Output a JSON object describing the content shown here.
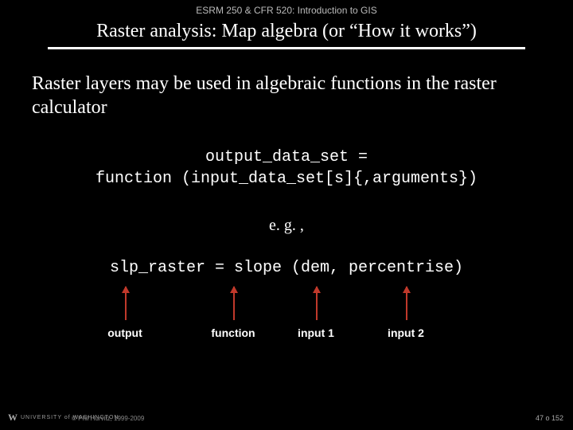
{
  "header": {
    "course": "ESRM 250 & CFR 520: Introduction to GIS"
  },
  "title": "Raster analysis: Map algebra (or “How it works”)",
  "body": "Raster layers may be used in algebraic functions in the raster calculator",
  "code1_line1": "output_data_set =",
  "code1_line2": "function (input_data_set[s]{,arguments})",
  "eg": "e. g. ,",
  "code2": "slp_raster = slope (dem, percentrise)",
  "labels": {
    "l1": "output",
    "l2": "function",
    "l3": "input 1",
    "l4": "input 2"
  },
  "footer": {
    "uni_w": "W",
    "uni_text": "UNIVERSITY of WASHINGTON",
    "copyright": "© Phil Hurvitz, 1999-2009",
    "page": "47 o 152"
  }
}
